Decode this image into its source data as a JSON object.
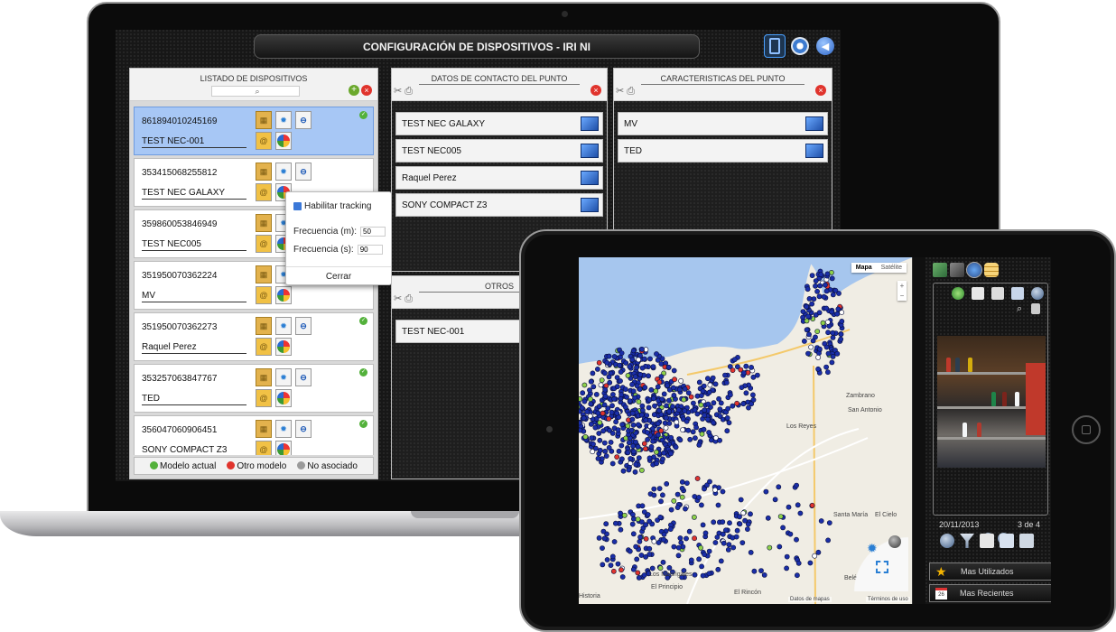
{
  "app": {
    "title": "CONFIGURACIÓN DE DISPOSITIVOS - IRI NI"
  },
  "panels": {
    "devices": {
      "title": "LISTADO DE DISPOSITIVOS",
      "items": [
        {
          "imei": "861894010245169",
          "name": "TEST NEC-001"
        },
        {
          "imei": "353415068255812",
          "name": "TEST NEC GALAXY"
        },
        {
          "imei": "359860053846949",
          "name": "TEST NEC005"
        },
        {
          "imei": "351950070362224",
          "name": "MV"
        },
        {
          "imei": "351950070362273",
          "name": "Raquel Perez"
        },
        {
          "imei": "353257063847767",
          "name": "TED"
        },
        {
          "imei": "356047060906451",
          "name": "SONY COMPACT Z3"
        }
      ]
    },
    "contact": {
      "title": "DATOS DE CONTACTO DEL PUNTO",
      "items": [
        "TEST NEC GALAXY",
        "TEST NEC005",
        "Raquel Perez",
        "SONY COMPACT Z3"
      ]
    },
    "features": {
      "title": "CARACTERISTICAS DEL PUNTO",
      "items": [
        "MV",
        "TED"
      ]
    },
    "others": {
      "title": "OTROS",
      "items": [
        "TEST NEC-001"
      ]
    }
  },
  "popup": {
    "tracking_label": "Habilitar tracking",
    "freq_m_label": "Frecuencia (m):",
    "freq_m_value": "50",
    "freq_s_label": "Frecuencia (s):",
    "freq_s_value": "90",
    "close_label": "Cerrar"
  },
  "legend": {
    "current": "Modelo actual",
    "other": "Otro modelo",
    "none": "No asociado"
  },
  "map": {
    "tab_map": "Mapa",
    "tab_sat": "Satélite",
    "labels": [
      "Zambrano",
      "San Antonio",
      "Los Reyes",
      "Santa María",
      "El Cielo",
      "Belén",
      "Los Madrigales",
      "El Principio",
      "El Rincón",
      "Historia"
    ],
    "footer_left": "Datos de mapas",
    "footer_right": "Términos de uso"
  },
  "gallery": {
    "date": "20/11/2013",
    "counter": "3 de 4"
  },
  "side_buttons": {
    "most_used": "Mas Utilizados",
    "recent": "Mas Recientes"
  },
  "colors": {
    "accent": "#3b78d8",
    "ok": "#53b13b",
    "error": "#e0342d",
    "neutral": "#9a9a9a",
    "pin": "#1a2ea8"
  }
}
